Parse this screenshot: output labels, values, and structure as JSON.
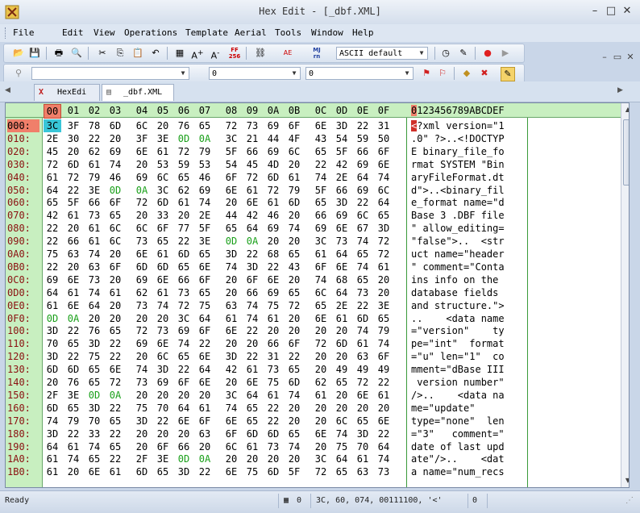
{
  "window": {
    "title": "Hex Edit - [_dbf.XML]",
    "minimize": "–",
    "maximize": "□",
    "close": "✕"
  },
  "menu": {
    "items": [
      "File",
      "Edit",
      "View",
      "Operations",
      "Template",
      "Aerial",
      "Tools",
      "Window",
      "Help"
    ],
    "mdi_minimize": "–",
    "mdi_restore": "▭",
    "mdi_close": "✕"
  },
  "toolbar1": {
    "charset_combo": "ASCII default",
    "buttons": [
      "open-folder-icon",
      "save-icon",
      "print-icon",
      "print-preview-icon",
      "cut-icon",
      "copy-icon",
      "paste-icon",
      "undo-icon",
      "calculator-icon",
      "font-larger-icon",
      "font-smaller-icon",
      "ff-256-icon",
      "link-icon",
      "ascii-ebcdic-icon",
      "mj-rn-icon",
      "clock-icon",
      "pen-icon",
      "record-icon",
      "play-icon"
    ],
    "ff_label": "FF 256",
    "mj_label": "MJ rn"
  },
  "toolbar2": {
    "combo_search": "",
    "combo_a": "0",
    "combo_b": "0"
  },
  "tabs": [
    {
      "label": "HexEdi",
      "active": false
    },
    {
      "label": "_dbf.XML",
      "active": true
    }
  ],
  "hex_header": [
    "00",
    "01",
    "02",
    "03",
    "04",
    "05",
    "06",
    "07",
    "08",
    "09",
    "0A",
    "0B",
    "0C",
    "0D",
    "0E",
    "0F"
  ],
  "ascii_header": "0123456789ABCDEF",
  "rows": [
    {
      "off": "000:",
      "hex": [
        "3C",
        "3F",
        "78",
        "6D",
        "6C",
        "20",
        "76",
        "65",
        "72",
        "73",
        "69",
        "6F",
        "6E",
        "3D",
        "22",
        "31"
      ],
      "ascii": "<?xml version=\"1"
    },
    {
      "off": "010:",
      "hex": [
        "2E",
        "30",
        "22",
        "20",
        "3F",
        "3E",
        "0D",
        "0A",
        "3C",
        "21",
        "44",
        "4F",
        "43",
        "54",
        "59",
        "50"
      ],
      "ascii": ".0\" ?>..<!DOCTYP"
    },
    {
      "off": "020:",
      "hex": [
        "45",
        "20",
        "62",
        "69",
        "6E",
        "61",
        "72",
        "79",
        "5F",
        "66",
        "69",
        "6C",
        "65",
        "5F",
        "66",
        "6F"
      ],
      "ascii": "E binary_file_fo"
    },
    {
      "off": "030:",
      "hex": [
        "72",
        "6D",
        "61",
        "74",
        "20",
        "53",
        "59",
        "53",
        "54",
        "45",
        "4D",
        "20",
        "22",
        "42",
        "69",
        "6E"
      ],
      "ascii": "rmat SYSTEM \"Bin"
    },
    {
      "off": "040:",
      "hex": [
        "61",
        "72",
        "79",
        "46",
        "69",
        "6C",
        "65",
        "46",
        "6F",
        "72",
        "6D",
        "61",
        "74",
        "2E",
        "64",
        "74"
      ],
      "ascii": "aryFileFormat.dt"
    },
    {
      "off": "050:",
      "hex": [
        "64",
        "22",
        "3E",
        "0D",
        "0A",
        "3C",
        "62",
        "69",
        "6E",
        "61",
        "72",
        "79",
        "5F",
        "66",
        "69",
        "6C"
      ],
      "ascii": "d\">..<binary_fil"
    },
    {
      "off": "060:",
      "hex": [
        "65",
        "5F",
        "66",
        "6F",
        "72",
        "6D",
        "61",
        "74",
        "20",
        "6E",
        "61",
        "6D",
        "65",
        "3D",
        "22",
        "64"
      ],
      "ascii": "e_format name=\"d"
    },
    {
      "off": "070:",
      "hex": [
        "42",
        "61",
        "73",
        "65",
        "20",
        "33",
        "20",
        "2E",
        "44",
        "42",
        "46",
        "20",
        "66",
        "69",
        "6C",
        "65"
      ],
      "ascii": "Base 3 .DBF file"
    },
    {
      "off": "080:",
      "hex": [
        "22",
        "20",
        "61",
        "6C",
        "6C",
        "6F",
        "77",
        "5F",
        "65",
        "64",
        "69",
        "74",
        "69",
        "6E",
        "67",
        "3D"
      ],
      "ascii": "\" allow_editing="
    },
    {
      "off": "090:",
      "hex": [
        "22",
        "66",
        "61",
        "6C",
        "73",
        "65",
        "22",
        "3E",
        "0D",
        "0A",
        "20",
        "20",
        "3C",
        "73",
        "74",
        "72"
      ],
      "ascii": "\"false\">..  <str"
    },
    {
      "off": "0A0:",
      "hex": [
        "75",
        "63",
        "74",
        "20",
        "6E",
        "61",
        "6D",
        "65",
        "3D",
        "22",
        "68",
        "65",
        "61",
        "64",
        "65",
        "72"
      ],
      "ascii": "uct name=\"header"
    },
    {
      "off": "0B0:",
      "hex": [
        "22",
        "20",
        "63",
        "6F",
        "6D",
        "6D",
        "65",
        "6E",
        "74",
        "3D",
        "22",
        "43",
        "6F",
        "6E",
        "74",
        "61"
      ],
      "ascii": "\" comment=\"Conta"
    },
    {
      "off": "0C0:",
      "hex": [
        "69",
        "6E",
        "73",
        "20",
        "69",
        "6E",
        "66",
        "6F",
        "20",
        "6F",
        "6E",
        "20",
        "74",
        "68",
        "65",
        "20"
      ],
      "ascii": "ins info on the "
    },
    {
      "off": "0D0:",
      "hex": [
        "64",
        "61",
        "74",
        "61",
        "62",
        "61",
        "73",
        "65",
        "20",
        "66",
        "69",
        "65",
        "6C",
        "64",
        "73",
        "20"
      ],
      "ascii": "database fields "
    },
    {
      "off": "0E0:",
      "hex": [
        "61",
        "6E",
        "64",
        "20",
        "73",
        "74",
        "72",
        "75",
        "63",
        "74",
        "75",
        "72",
        "65",
        "2E",
        "22",
        "3E"
      ],
      "ascii": "and structure.\">"
    },
    {
      "off": "0F0:",
      "hex": [
        "0D",
        "0A",
        "20",
        "20",
        "20",
        "20",
        "3C",
        "64",
        "61",
        "74",
        "61",
        "20",
        "6E",
        "61",
        "6D",
        "65"
      ],
      "ascii": "..    <data name"
    },
    {
      "off": "100:",
      "hex": [
        "3D",
        "22",
        "76",
        "65",
        "72",
        "73",
        "69",
        "6F",
        "6E",
        "22",
        "20",
        "20",
        "20",
        "20",
        "74",
        "79"
      ],
      "ascii": "=\"version\"    ty"
    },
    {
      "off": "110:",
      "hex": [
        "70",
        "65",
        "3D",
        "22",
        "69",
        "6E",
        "74",
        "22",
        "20",
        "20",
        "66",
        "6F",
        "72",
        "6D",
        "61",
        "74"
      ],
      "ascii": "pe=\"int\"  format"
    },
    {
      "off": "120:",
      "hex": [
        "3D",
        "22",
        "75",
        "22",
        "20",
        "6C",
        "65",
        "6E",
        "3D",
        "22",
        "31",
        "22",
        "20",
        "20",
        "63",
        "6F"
      ],
      "ascii": "=\"u\" len=\"1\"  co"
    },
    {
      "off": "130:",
      "hex": [
        "6D",
        "6D",
        "65",
        "6E",
        "74",
        "3D",
        "22",
        "64",
        "42",
        "61",
        "73",
        "65",
        "20",
        "49",
        "49",
        "49"
      ],
      "ascii": "mment=\"dBase III"
    },
    {
      "off": "140:",
      "hex": [
        "20",
        "76",
        "65",
        "72",
        "73",
        "69",
        "6F",
        "6E",
        "20",
        "6E",
        "75",
        "6D",
        "62",
        "65",
        "72",
        "22"
      ],
      "ascii": " version number\""
    },
    {
      "off": "150:",
      "hex": [
        "2F",
        "3E",
        "0D",
        "0A",
        "20",
        "20",
        "20",
        "20",
        "3C",
        "64",
        "61",
        "74",
        "61",
        "20",
        "6E",
        "61"
      ],
      "ascii": "/>..    <data na"
    },
    {
      "off": "160:",
      "hex": [
        "6D",
        "65",
        "3D",
        "22",
        "75",
        "70",
        "64",
        "61",
        "74",
        "65",
        "22",
        "20",
        "20",
        "20",
        "20",
        "20"
      ],
      "ascii": "me=\"update\"     "
    },
    {
      "off": "170:",
      "hex": [
        "74",
        "79",
        "70",
        "65",
        "3D",
        "22",
        "6E",
        "6F",
        "6E",
        "65",
        "22",
        "20",
        "20",
        "6C",
        "65",
        "6E"
      ],
      "ascii": "type=\"none\"  len"
    },
    {
      "off": "180:",
      "hex": [
        "3D",
        "22",
        "33",
        "22",
        "20",
        "20",
        "20",
        "63",
        "6F",
        "6D",
        "6D",
        "65",
        "6E",
        "74",
        "3D",
        "22"
      ],
      "ascii": "=\"3\"   comment=\""
    },
    {
      "off": "190:",
      "hex": [
        "64",
        "61",
        "74",
        "65",
        "20",
        "6F",
        "66",
        "20",
        "6C",
        "61",
        "73",
        "74",
        "20",
        "75",
        "70",
        "64"
      ],
      "ascii": "date of last upd"
    },
    {
      "off": "1A0:",
      "hex": [
        "61",
        "74",
        "65",
        "22",
        "2F",
        "3E",
        "0D",
        "0A",
        "20",
        "20",
        "20",
        "20",
        "3C",
        "64",
        "61",
        "74"
      ],
      "ascii": "ate\"/>..    <dat"
    },
    {
      "off": "1B0:",
      "hex": [
        "61",
        "20",
        "6E",
        "61",
        "6D",
        "65",
        "3D",
        "22",
        "6E",
        "75",
        "6D",
        "5F",
        "72",
        "65",
        "63",
        "73"
      ],
      "ascii": "a name=\"num_recs"
    }
  ],
  "status": {
    "ready": "Ready",
    "count_a": "0",
    "values": "3C, 60, 074, 00111100, '<'",
    "count_b": "0"
  },
  "colors": {
    "header_bg": "#c8efc0",
    "selected_col": "#f07f6a",
    "cursor_hex": "#38c6d8",
    "cursor_ascii": "#d0302a",
    "newline_bytes": "#1aa01a",
    "offset_text": "#8a1010"
  }
}
